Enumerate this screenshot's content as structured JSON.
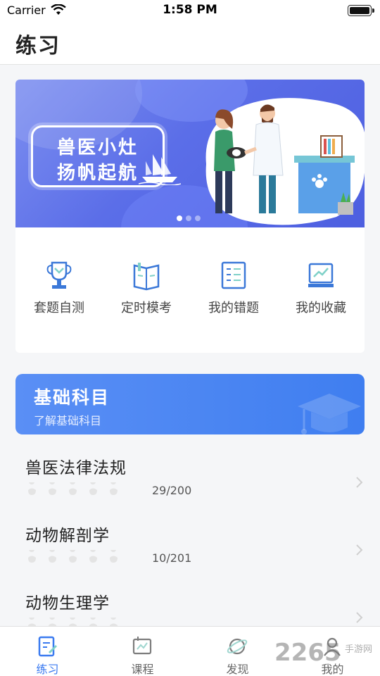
{
  "status_bar": {
    "carrier": "Carrier",
    "time": "1:58 PM"
  },
  "header": {
    "title": "练习"
  },
  "banner": {
    "line1": "兽医小灶",
    "line2": "扬帆起航",
    "slide_count": 3,
    "active_slide": 0
  },
  "quick_actions": [
    {
      "label": "套题自测",
      "icon": "trophy-icon"
    },
    {
      "label": "定时模考",
      "icon": "book-icon"
    },
    {
      "label": "我的错题",
      "icon": "error-list-icon"
    },
    {
      "label": "我的收藏",
      "icon": "chart-screen-icon"
    }
  ],
  "section": {
    "title": "基础科目",
    "subtitle": "了解基础科目",
    "icon": "graduation-cap-icon"
  },
  "subjects": [
    {
      "name": "兽医法律法规",
      "progress": "29/200",
      "stars": 5
    },
    {
      "name": "动物解剖学",
      "progress": "10/201",
      "stars": 5
    },
    {
      "name": "动物生理学",
      "progress": "",
      "stars": 5
    }
  ],
  "tabs": [
    {
      "label": "练习",
      "icon": "practice-icon",
      "active": true
    },
    {
      "label": "课程",
      "icon": "course-icon",
      "active": false
    },
    {
      "label": "发现",
      "icon": "planet-icon",
      "active": false
    },
    {
      "label": "我的",
      "icon": "profile-icon",
      "active": false
    }
  ],
  "watermark": {
    "text": "2265",
    "sub": "手游网"
  },
  "colors": {
    "accent": "#3a7af0",
    "banner": "#5b6ee8",
    "icon": "#3b78d8"
  }
}
